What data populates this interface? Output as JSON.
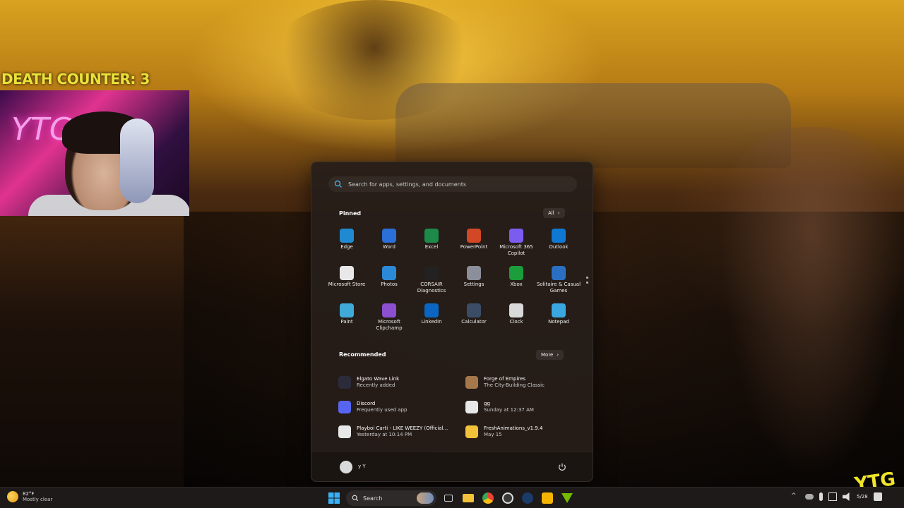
{
  "overlay": {
    "death_counter": "DEATH COUNTER: 3",
    "webcam_neon_text": "YTG",
    "corner_logo": "YTG"
  },
  "start_menu": {
    "search_placeholder": "Search for apps, settings, and documents",
    "pinned": {
      "title": "Pinned",
      "all_button": "All",
      "apps": [
        {
          "label": "Edge",
          "icon": "edge-icon",
          "color": "#1f8ad2"
        },
        {
          "label": "Word",
          "icon": "word-icon",
          "color": "#2b6fd8"
        },
        {
          "label": "Excel",
          "icon": "excel-icon",
          "color": "#1d8a4a"
        },
        {
          "label": "PowerPoint",
          "icon": "powerpoint-icon",
          "color": "#d24726"
        },
        {
          "label": "Microsoft 365 Copilot",
          "icon": "m365-copilot-icon",
          "color": "#7b5cf0"
        },
        {
          "label": "Outlook",
          "icon": "outlook-icon",
          "color": "#0f78d4"
        },
        {
          "label": "Microsoft Store",
          "icon": "store-icon",
          "color": "#e8e8e8"
        },
        {
          "label": "Photos",
          "icon": "photos-icon",
          "color": "#2b8ad8"
        },
        {
          "label": "CORSAIR Diagnostics",
          "icon": "corsair-icon",
          "color": "#222222"
        },
        {
          "label": "Settings",
          "icon": "gear-icon",
          "color": "#8a8f99"
        },
        {
          "label": "Xbox",
          "icon": "xbox-icon",
          "color": "#1a9d3a"
        },
        {
          "label": "Solitaire & Casual Games",
          "icon": "cards-icon",
          "color": "#2a6fc2"
        },
        {
          "label": "Paint",
          "icon": "paint-icon",
          "color": "#3fa9d8"
        },
        {
          "label": "Microsoft Clipchamp",
          "icon": "clipchamp-icon",
          "color": "#8b4fd0"
        },
        {
          "label": "LinkedIn",
          "icon": "linkedin-icon",
          "color": "#0a66c2"
        },
        {
          "label": "Calculator",
          "icon": "calculator-icon",
          "color": "#3b4d66"
        },
        {
          "label": "Clock",
          "icon": "clock-icon",
          "color": "#d9d9d9"
        },
        {
          "label": "Notepad",
          "icon": "notepad-icon",
          "color": "#3aa7e0"
        }
      ]
    },
    "recommended": {
      "title": "Recommended",
      "more_button": "More",
      "items": [
        {
          "name": "Elgato Wave Link",
          "sub": "Recently added",
          "icon": "wavelink-icon",
          "color": "#2b2b3a"
        },
        {
          "name": "Forge of Empires",
          "sub": "The City-Building Classic",
          "icon": "forge-of-empires-icon",
          "color": "#a5774a"
        },
        {
          "name": "Discord",
          "sub": "Frequently used app",
          "icon": "discord-icon",
          "color": "#5865f2"
        },
        {
          "name": "gg",
          "sub": "Sunday at 12:37 AM",
          "icon": "image-file-icon",
          "color": "#e8e8e8"
        },
        {
          "name": "Playboi Carti - LIKE WEEZY (Official...",
          "sub": "Yesterday at 10:14 PM",
          "icon": "media-file-icon",
          "color": "#e8e8e8"
        },
        {
          "name": "FreshAnimations_v1.9.4",
          "sub": "May 15",
          "icon": "folder-icon",
          "color": "#f2c23a"
        }
      ]
    },
    "user": {
      "name": "y Y"
    }
  },
  "taskbar": {
    "weather": {
      "temp": "82°F",
      "condition": "Mostly clear"
    },
    "search_label": "Search",
    "apps": [
      "task-view-icon",
      "file-explorer-icon",
      "chrome-icon",
      "obs-icon",
      "steam-icon",
      "rockstar-icon",
      "nvidia-icon"
    ],
    "clock_partial": "5/28"
  }
}
